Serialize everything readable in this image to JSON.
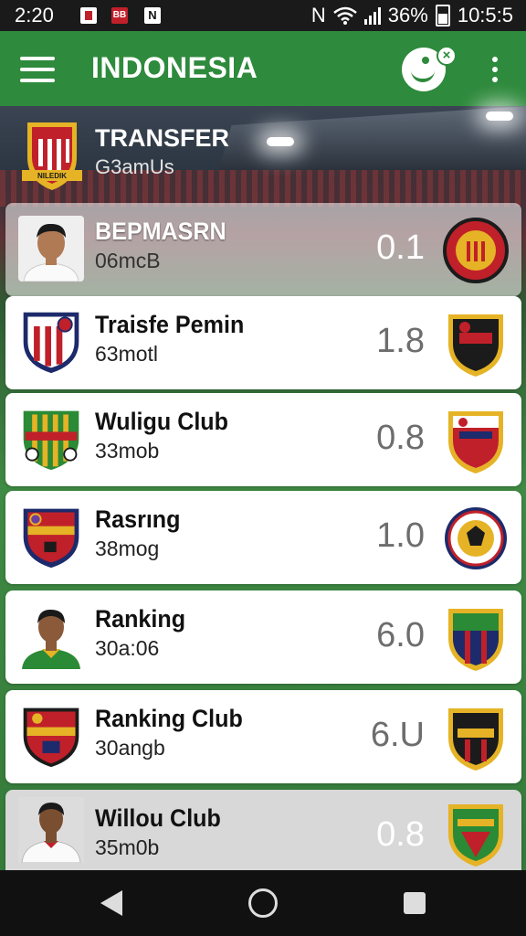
{
  "status_bar": {
    "time": "2:20",
    "notif_2": "BB",
    "notif_3": "N",
    "network": "N",
    "battery": "36%",
    "clock": "10:5:5"
  },
  "app_bar": {
    "title": "INDONESIA"
  },
  "header": {
    "title": "TRANSFER",
    "subtitle": "G3amUs",
    "crest_text": "NILEDIK"
  },
  "rows": [
    {
      "title": "BEPMASRN",
      "sub": "06mcB",
      "value": "0.1"
    },
    {
      "title": "Traisfe Pemin",
      "sub": "63motl",
      "value": "1.8"
    },
    {
      "title": "Wuligu Club",
      "sub": "33mob",
      "value": "0.8"
    },
    {
      "title": "Rasrıng",
      "sub": "38mog",
      "value": "1.0"
    },
    {
      "title": "Ranking",
      "sub": "30a:06",
      "value": "6.0"
    },
    {
      "title": "Ranking Club",
      "sub": "30angb",
      "value": "6.U"
    },
    {
      "title": "Willou Club",
      "sub": "35m0b",
      "value": "0.8"
    }
  ],
  "colors": {
    "app_bar": "#2e8a3c",
    "crest_red": "#c0202a",
    "crest_gold": "#e5b325",
    "crest_black": "#1b1b1b",
    "crest_green": "#2a8a35"
  }
}
